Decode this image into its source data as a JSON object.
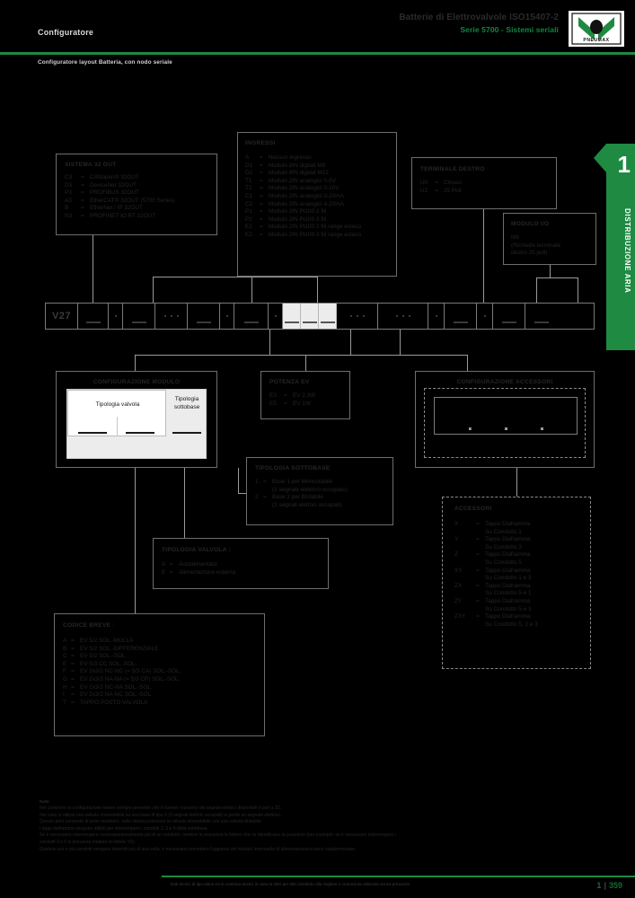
{
  "header": {
    "left_label": "Configuratore",
    "title": "Batterie di Elettrovalvole ISO15407-2",
    "subtitle_green": "Serie 5700 - Sistemi seriali",
    "page_subtitle": "Configuratore layout Batteria, con nodo seriale",
    "logo_text": "PNEUMAX"
  },
  "side_tab": {
    "number": "1",
    "label": "DISTRIBUZIONE ARIA",
    "color": "#1f8a42"
  },
  "sistema": {
    "title": "SISTEMA 32 OUT",
    "rows": [
      {
        "code": "C3",
        "eq": "=",
        "text": "CANopen® 32OUT"
      },
      {
        "code": "D3",
        "eq": "=",
        "text": "DeviceNet 32OUT"
      },
      {
        "code": "P3",
        "eq": "=",
        "text": "PROFIBUS 32OUT"
      },
      {
        "code": "A3",
        "eq": "=",
        "text": "EtherCAT® 32OUT (5700 Series)"
      },
      {
        "code": "B",
        "eq": "=",
        "text": "EtherNet / IP 32OUT"
      },
      {
        "code": "N3",
        "eq": "=",
        "text": "PROFINET IO RT 32OUT"
      }
    ]
  },
  "ingressi": {
    "title": "INGRESSI",
    "rows": [
      {
        "code": "A",
        "eq": "=",
        "text": "Nessun ingresso"
      },
      {
        "code": "D1",
        "eq": "=",
        "text": "Modulo 8IN digitali M8"
      },
      {
        "code": "D2",
        "eq": "=",
        "text": "Modulo 8IN digitali M12"
      },
      {
        "code": "T1",
        "eq": "=",
        "text": "Modulo 2IN analogici 0-5V"
      },
      {
        "code": "T2",
        "eq": "=",
        "text": "Modulo 2IN analogici 0-10V"
      },
      {
        "code": "C1",
        "eq": "=",
        "text": "Modulo 2IN analogici 0-20mA"
      },
      {
        "code": "C2",
        "eq": "=",
        "text": "Modulo 2IN analogici 4-20mA"
      },
      {
        "code": "P1",
        "eq": "=",
        "text": "Modulo 2IN Pt100 2 fili"
      },
      {
        "code": "P2",
        "eq": "=",
        "text": "Modulo 2IN Pt100 3 fili"
      },
      {
        "code": "E1",
        "eq": "=",
        "text": "Modulo 2IN Pt100 2 fili range esteso"
      },
      {
        "code": "E2",
        "eq": "=",
        "text": "Modulo 2IN Pt100 3 fili range esteso"
      }
    ]
  },
  "terminale_destro": {
    "title": "TERMINALE DESTRO",
    "rows": [
      {
        "code": "U0",
        "eq": "=",
        "text": "Chiuso"
      },
      {
        "code": "U2",
        "eq": "=",
        "text": "25 Poli"
      }
    ]
  },
  "modulo_io": {
    "title": "MODULO I/O",
    "lines": [
      "M6",
      "(Richiede terminale",
      "destro 25 poli)"
    ]
  },
  "code_bar": {
    "prefix": "V27",
    "cells": [
      {
        "kind": "text",
        "value": "V27",
        "width": 36
      },
      {
        "kind": "dash",
        "width": 34
      },
      {
        "kind": "dot",
        "width": 16
      },
      {
        "kind": "dash",
        "width": 36
      },
      {
        "kind": "dots3",
        "width": 36
      },
      {
        "kind": "dash",
        "width": 36
      },
      {
        "kind": "dot",
        "width": 16
      },
      {
        "kind": "dash",
        "width": 38
      },
      {
        "kind": "dot",
        "width": 16
      },
      {
        "kind": "dash",
        "width": 20,
        "lit": true
      },
      {
        "kind": "dash",
        "width": 20,
        "lit": true
      },
      {
        "kind": "dash",
        "width": 20,
        "lit": true
      },
      {
        "kind": "dots3",
        "width": 46
      },
      {
        "kind": "dots3",
        "width": 56
      },
      {
        "kind": "dot",
        "width": 18
      },
      {
        "kind": "dash",
        "width": 36
      },
      {
        "kind": "dot",
        "width": 18
      },
      {
        "kind": "dash",
        "width": 36
      },
      {
        "kind": "dash",
        "width": 36
      }
    ]
  },
  "conf_modulo": {
    "title": "CONFIGURAZIONE MODULO",
    "label_valvola": "Tipologia valvola",
    "label_sottobase": "Tipologia sottobase"
  },
  "potenza_ev": {
    "title": "POTENZA EV",
    "rows": [
      {
        "code": "E3",
        "eq": "=",
        "text": "EV 2,3W"
      },
      {
        "code": "E5",
        "eq": "=",
        "text": "EV 1W"
      }
    ]
  },
  "conf_accessori": {
    "title": "CONFIGURAZIONE ACCESSORI"
  },
  "tipologia_sottobase": {
    "title": "TIPOLOGIA SOTTOBASE",
    "rows": [
      {
        "code": "1",
        "eq": "=",
        "text": "Base 1 per Monostabile",
        "sub": "(1 segnale elettrico occupato)"
      },
      {
        "code": "2",
        "eq": "=",
        "text": "Base 2 per Bistabile",
        "sub": "(2 segnali elettrici occupati)"
      }
    ]
  },
  "tipologia_valvola": {
    "title": "TIPOLOGIA VALVOLA :",
    "rows": [
      {
        "code": "A",
        "eq": "=",
        "text": "Autoalimentata"
      },
      {
        "code": "E",
        "eq": "=",
        "text": "Alimentazione esterna"
      }
    ]
  },
  "codice_breve": {
    "title": "CODICE BREVE :",
    "rows": [
      {
        "code": "A",
        "eq": "=",
        "text": "EV 5/2 SOL.-MOLLA"
      },
      {
        "code": "B",
        "eq": "=",
        "text": "EV 5/2 SOL.-DIFFERENZIALE"
      },
      {
        "code": "C",
        "eq": "=",
        "text": "EV 5/2 SOL.-SOL."
      },
      {
        "code": "E",
        "eq": "=",
        "text": "EV 5/3 CC SOL.-SOL."
      },
      {
        "code": "F",
        "eq": "=",
        "text": "EV 2x3/2 NC-NC (= 5/3 CA) SOL.-SOL."
      },
      {
        "code": "G",
        "eq": "=",
        "text": "EV 2x3/2 NA-NA (= 5/3 CP) SOL.-SOL."
      },
      {
        "code": "H",
        "eq": "=",
        "text": "EV 2x3/2 NC-NA SOL.-SOL."
      },
      {
        "code": "I",
        "eq": "=",
        "text": "EV 2x3/2 NA-NC SOL.-SOL."
      },
      {
        "code": "T",
        "eq": "=",
        "text": "TAPPO POSTO VALVOLA"
      }
    ]
  },
  "accessori": {
    "title": "ACCESSORI",
    "rows": [
      {
        "code": "X",
        "eq": "=",
        "text": "Tappo Diaframma",
        "sub": "Su Condotto 1"
      },
      {
        "code": "Y",
        "eq": "=",
        "text": "Tappo Diaframma",
        "sub": "Su Condotto 3"
      },
      {
        "code": "Z",
        "eq": "=",
        "text": "Tappo Diaframma",
        "sub": "Su Condotto 5"
      },
      {
        "code": "XY",
        "eq": "=",
        "text": "Tappo Diaframma",
        "sub": "Su Condotto 1 e 3"
      },
      {
        "code": "ZX",
        "eq": "=",
        "text": "Tappo Diaframma",
        "sub": "Su Condotto 5 e 1"
      },
      {
        "code": "ZY",
        "eq": "=",
        "text": "Tappo Diaframma",
        "sub": "Su Condotto 5 e 3"
      },
      {
        "code": "ZXY",
        "eq": "=",
        "text": "Tappo Diaframma",
        "sub": "Su Condotto 5, 1 e 3"
      }
    ]
  },
  "notes": {
    "title": "Note:",
    "lines": [
      "Nel comporre la configurazione tenere sempre presente che il numero massimo dei segnali elettrici disponibili è pari a 32.",
      "Nel caso si utilizzi una valvola monostabile su una base di tipo 2 (2 segnali elettrici occupati) si perde un segnale elettrico.",
      "Questo però consente di poter sostituire, nella stessa posizione la valvola monostabile con una valvola bistabile.",
      "I tappi diaframma vengono adibiti per interrompere i condotti 1, 3 e 5 della sottobase.",
      "Se è necessario interrompere contemporaneamente più di un condotto, mettere in sequenza le lettere che ne identificano la posizione (per esempio: se è necessario interrompere i",
      "condotti 3 e 5 si dovranno mettere le lettere YZ).",
      "Qualora uno o più condotti vengano interrotti più di una volta, è necessario prevedere l'aggiunta del modulo intermedio di alimentazione/scarico supplementare."
    ]
  },
  "footer": {
    "text": "Dati tecnici di tipo stimo ed in continuo tecnici in caso la oltre per altri chiederlo alla migliore o conosciuta utilizzata senza preavviso",
    "section": "1",
    "page": "359"
  }
}
